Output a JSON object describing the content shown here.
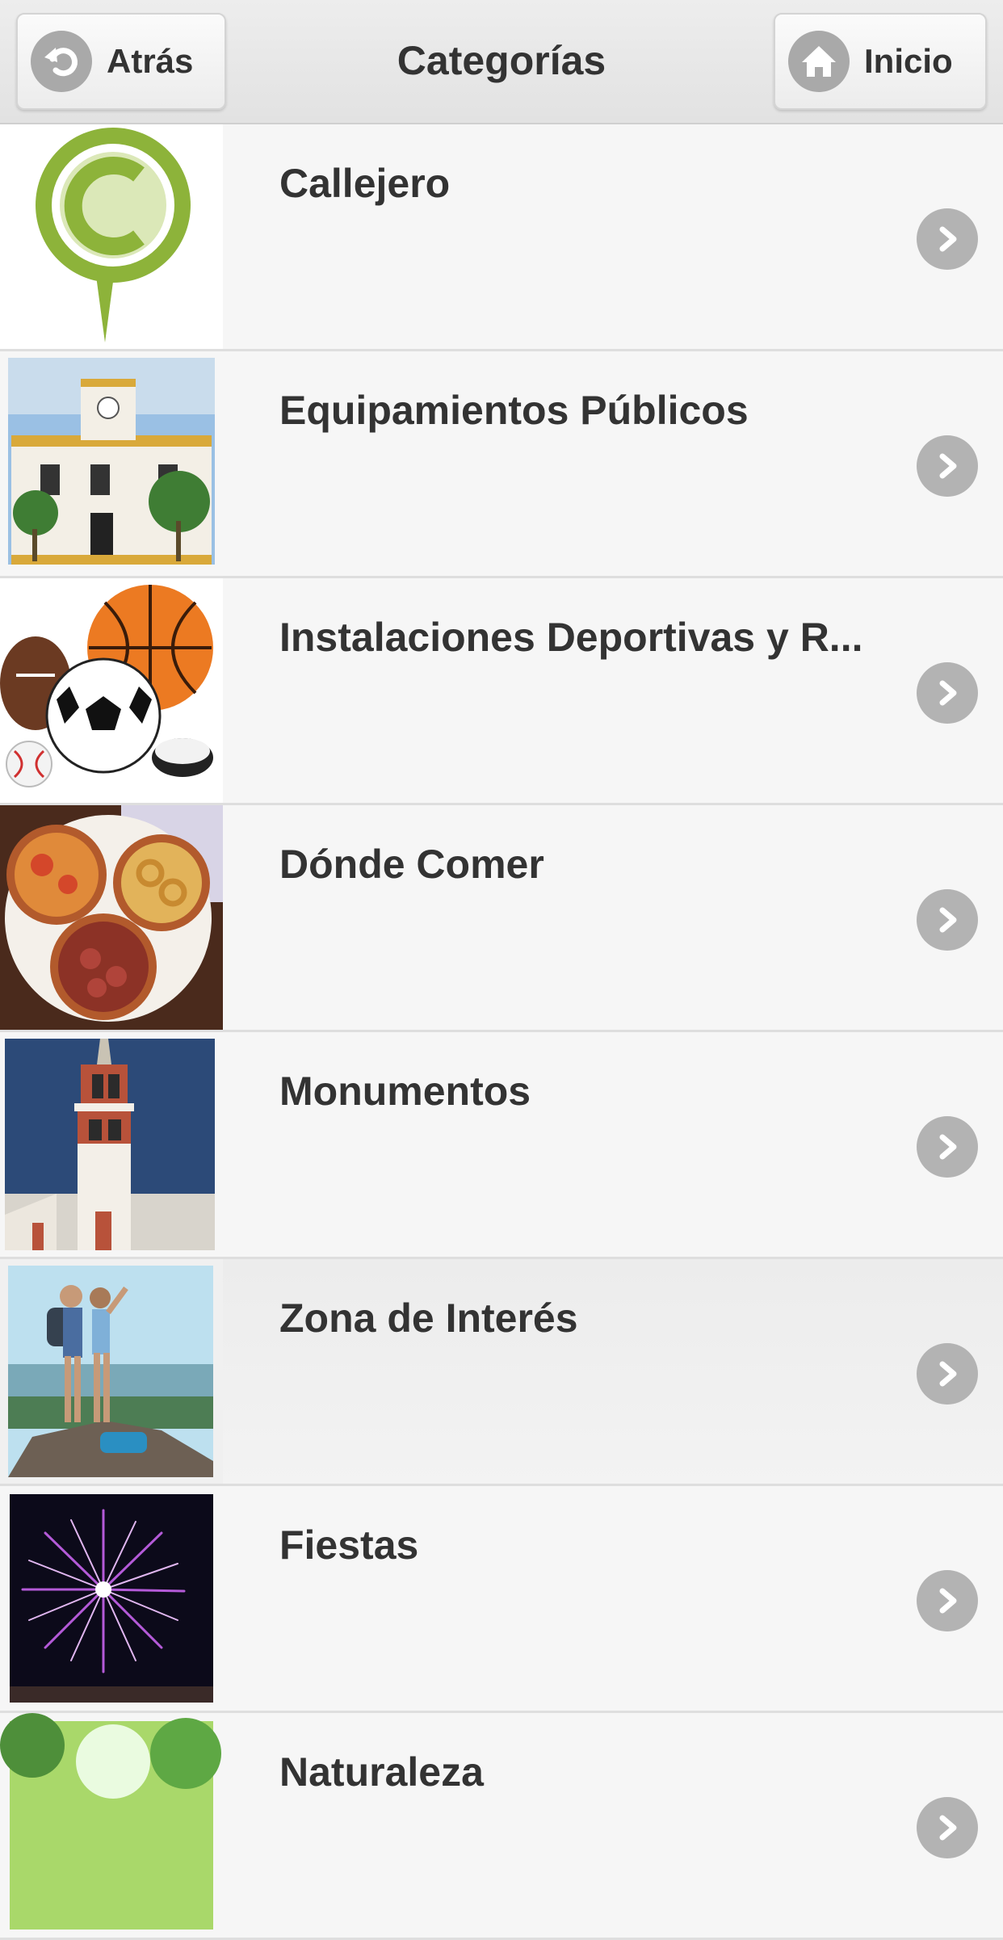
{
  "header": {
    "title": "Categorías",
    "back_label": "Atrás",
    "home_label": "Inicio"
  },
  "categories": [
    {
      "label": "Callejero",
      "icon": "callejero-pin-icon"
    },
    {
      "label": "Equipamientos Públicos",
      "icon": "town-hall-photo"
    },
    {
      "label": "Instalaciones Deportivas y R...",
      "icon": "sports-balls-photo"
    },
    {
      "label": "Dónde Comer",
      "icon": "tapas-photo"
    },
    {
      "label": "Monumentos",
      "icon": "church-tower-photo"
    },
    {
      "label": "Zona de Interés",
      "icon": "hikers-photo"
    },
    {
      "label": "Fiestas",
      "icon": "fireworks-photo"
    },
    {
      "label": "Naturaleza",
      "icon": "nature-photo"
    }
  ],
  "colors": {
    "chevron": "#b3b3b3",
    "pin_green": "#8db33a",
    "text": "#333333"
  }
}
